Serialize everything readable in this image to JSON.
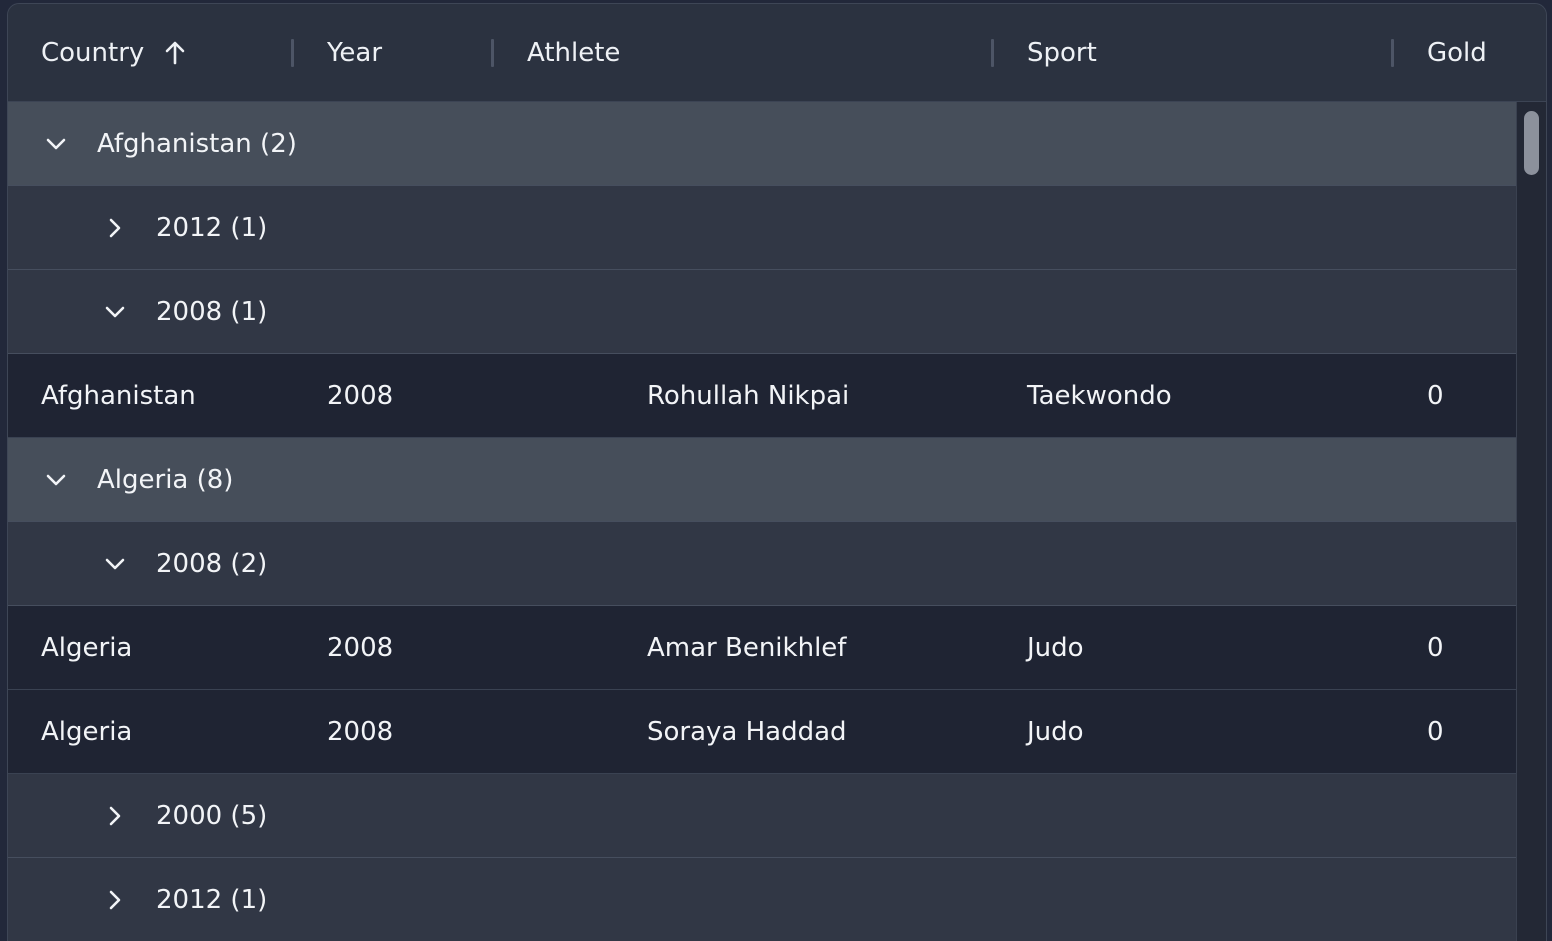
{
  "columns": {
    "country": "Country",
    "year": "Year",
    "athlete": "Athlete",
    "sport": "Sport",
    "gold": "Gold"
  },
  "sort": {
    "column": "Country",
    "direction": "ascending",
    "icon": "arrow-up-icon"
  },
  "rows": [
    {
      "type": "group",
      "level": 1,
      "expanded": true,
      "label": "Afghanistan (2)"
    },
    {
      "type": "group",
      "level": 2,
      "expanded": false,
      "label": "2012 (1)"
    },
    {
      "type": "group",
      "level": 2,
      "expanded": true,
      "label": "2008 (1)"
    },
    {
      "type": "leaf",
      "country": "Afghanistan",
      "year": "2008",
      "athlete": "Rohullah Nikpai",
      "sport": "Taekwondo",
      "gold": "0"
    },
    {
      "type": "group",
      "level": 1,
      "expanded": true,
      "label": "Algeria (8)"
    },
    {
      "type": "group",
      "level": 2,
      "expanded": true,
      "label": "2008 (2)"
    },
    {
      "type": "leaf",
      "country": "Algeria",
      "year": "2008",
      "athlete": "Amar Benikhlef",
      "sport": "Judo",
      "gold": "0"
    },
    {
      "type": "leaf",
      "country": "Algeria",
      "year": "2008",
      "athlete": "Soraya Haddad",
      "sport": "Judo",
      "gold": "0"
    },
    {
      "type": "group",
      "level": 2,
      "expanded": false,
      "label": "2000 (5)"
    },
    {
      "type": "group",
      "level": 2,
      "expanded": false,
      "label": "2012 (1)"
    }
  ],
  "colors": {
    "header_bg": "#2b3240",
    "group1_bg": "#464e5a",
    "group2_bg": "#313745",
    "leaf_bg": "#1f2433",
    "text": "#f2f4f7"
  }
}
